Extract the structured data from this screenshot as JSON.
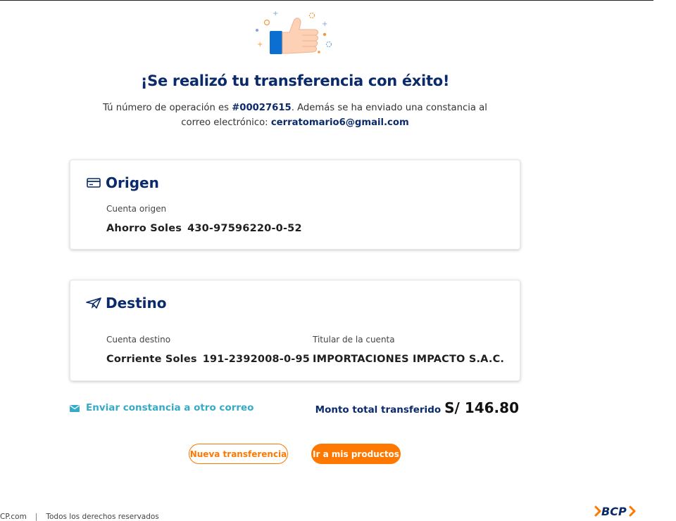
{
  "title": "¡Se realizó tu transferencia con éxito!",
  "message": {
    "prefix": "Tú número de operación es ",
    "operation_number": "#00027615",
    "middle": ". Además se ha enviado una constancia al correo electrónico: ",
    "email": "cerratomario6@gmail.com"
  },
  "origen": {
    "icon": "card-icon",
    "title": "Origen",
    "account_label": "Cuenta origen",
    "account_type": "Ahorro Soles",
    "account_number": "430-97596220-0-52"
  },
  "destino": {
    "icon": "paper-plane-icon",
    "title": "Destino",
    "account_label": "Cuenta destino",
    "account_type": "Corriente Soles",
    "account_number": "191-2392008-0-95",
    "holder_label": "Titular de la cuenta",
    "holder_name": "IMPORTACIONES IMPACTO S.A.C."
  },
  "resend_link": "Enviar constancia a otro correo",
  "total": {
    "label": "Monto total transferido",
    "amount": "S/ 146.80"
  },
  "buttons": {
    "new_transfer": "Nueva transferencia",
    "my_products": "Ir a mis productos"
  },
  "footer": {
    "site": "CP.com",
    "separator": "|",
    "rights": "Todos los derechos reservados"
  },
  "logo_text": "BCP",
  "colors": {
    "primary_navy": "#0a2a6b",
    "accent_orange": "#ff7800",
    "link_teal": "#36aac7",
    "thumb_blue": "#0a6fd1",
    "thumb_skin": "#fcd1b5"
  }
}
